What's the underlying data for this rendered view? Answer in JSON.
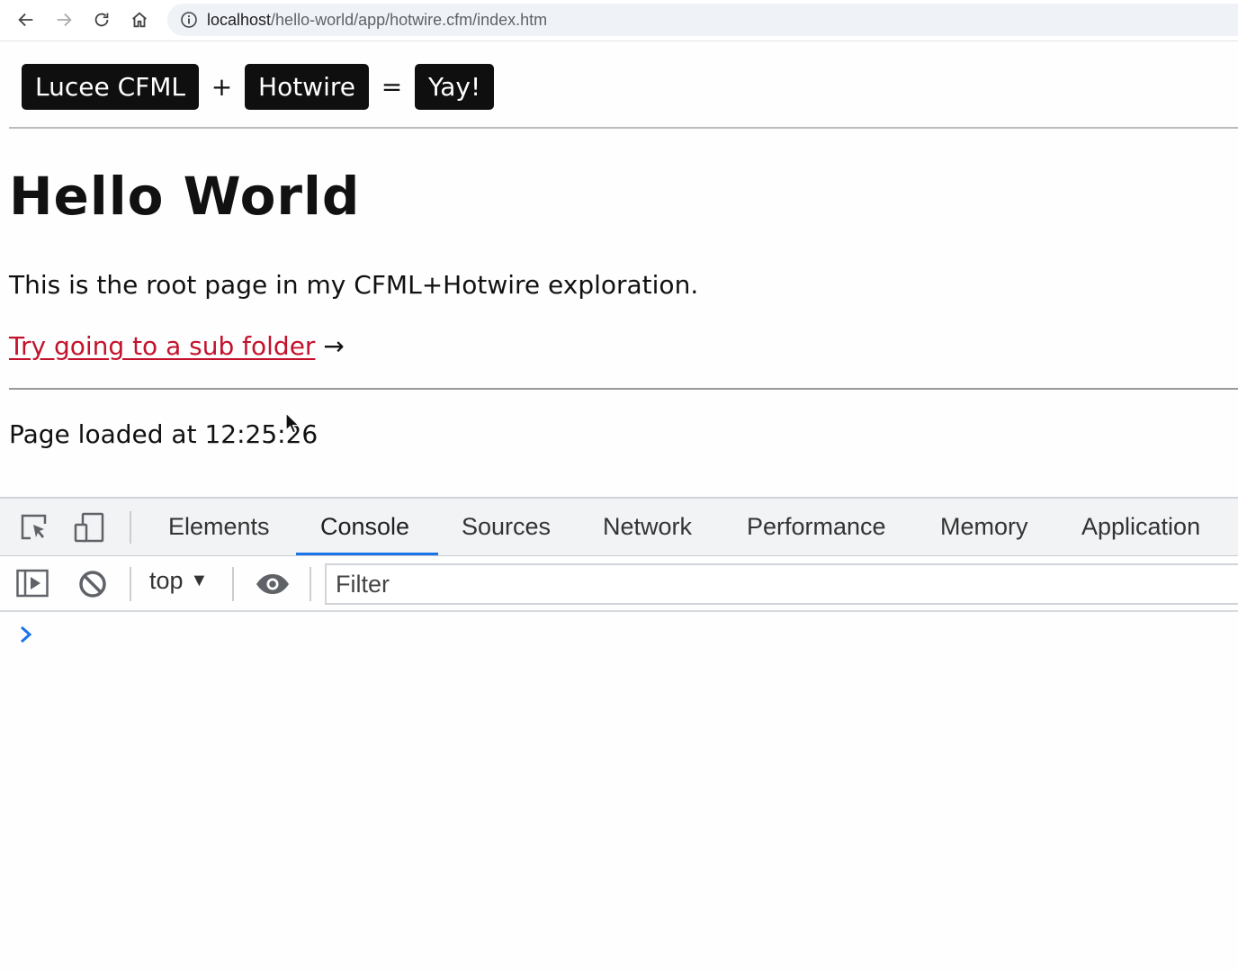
{
  "browser": {
    "url_host": "localhost",
    "url_path": "/hello-world/app/hotwire.cfm/index.htm"
  },
  "page": {
    "banner": {
      "tag1": "Lucee CFML",
      "op1": "+",
      "tag2": "Hotwire",
      "op2": "=",
      "tag3": "Yay!"
    },
    "title": "Hello World",
    "intro": "This is the root page in my CFML+Hotwire exploration.",
    "link_text": "Try going to a sub folder",
    "link_arrow": "→",
    "loaded_text": "Page loaded at 12:25:26"
  },
  "devtools": {
    "tabs": [
      {
        "label": "Elements"
      },
      {
        "label": "Console",
        "active": true
      },
      {
        "label": "Sources"
      },
      {
        "label": "Network"
      },
      {
        "label": "Performance"
      },
      {
        "label": "Memory"
      },
      {
        "label": "Application"
      }
    ],
    "context": "top",
    "filter_placeholder": "Filter",
    "accent_color": "#1a73e8"
  }
}
